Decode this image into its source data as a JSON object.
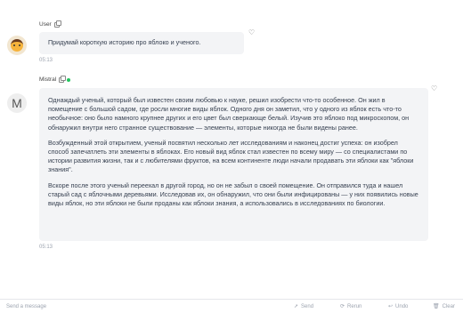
{
  "user_message": {
    "sender": "User",
    "text": "Придумай короткую историю про яблоко и ученого.",
    "time": "05:13"
  },
  "assistant_message": {
    "sender": "Mistral",
    "avatar_letter": "M",
    "paragraphs": [
      "Однаждый ученый, который был известен своим любовью к науке, решил изобрести что-то особенное. Он жил в помещение с большой садом, где росли многие виды яблок. Одного дня он заметил, что у одного из яблок есть что-то необычное: оно было намного крупнее других и его цвет был сверкающе белый. Изучив это яблоко под микроскопом, он обнаружил внутри него странное существование — элементы, которые никогда не были видены ранее.",
      "Возбужденный этой открытием, ученый посвятил несколько лет исследованиям и наконец достиг успеха: он изобрел способ запечатлеть эти элементы в яблоках. Его новый вид яблок стал известен по всему миру — со специалистами по истории развития жизни, так и с любителями фруктов, на всем континенте люди начали продавать эти яблоки как \"яблоки знания\".",
      "Вскоре после этого ученый переехал в другой город, но он не забыл о своей помещение. Он отправился туда и нашел старый сад с яблочными деревьями. Исследовав их, он обнаружил, что они были инфицированы — у них появились новые виды яблок, но эти яблоки не были проданы как яблоки знания, а использовались в исследованиях по биологии."
    ],
    "time": "05:13"
  },
  "composer": {
    "placeholder": "Send a message",
    "send_label": "Send",
    "rerun_label": "Rerun",
    "undo_label": "Undo",
    "clear_label": "Clear"
  },
  "icons": {
    "copy": "copy-icon",
    "heart": "heart-icon",
    "online": "online-dot"
  },
  "colors": {
    "bubble_bg": "#f3f4f6",
    "online": "#22c55e"
  }
}
